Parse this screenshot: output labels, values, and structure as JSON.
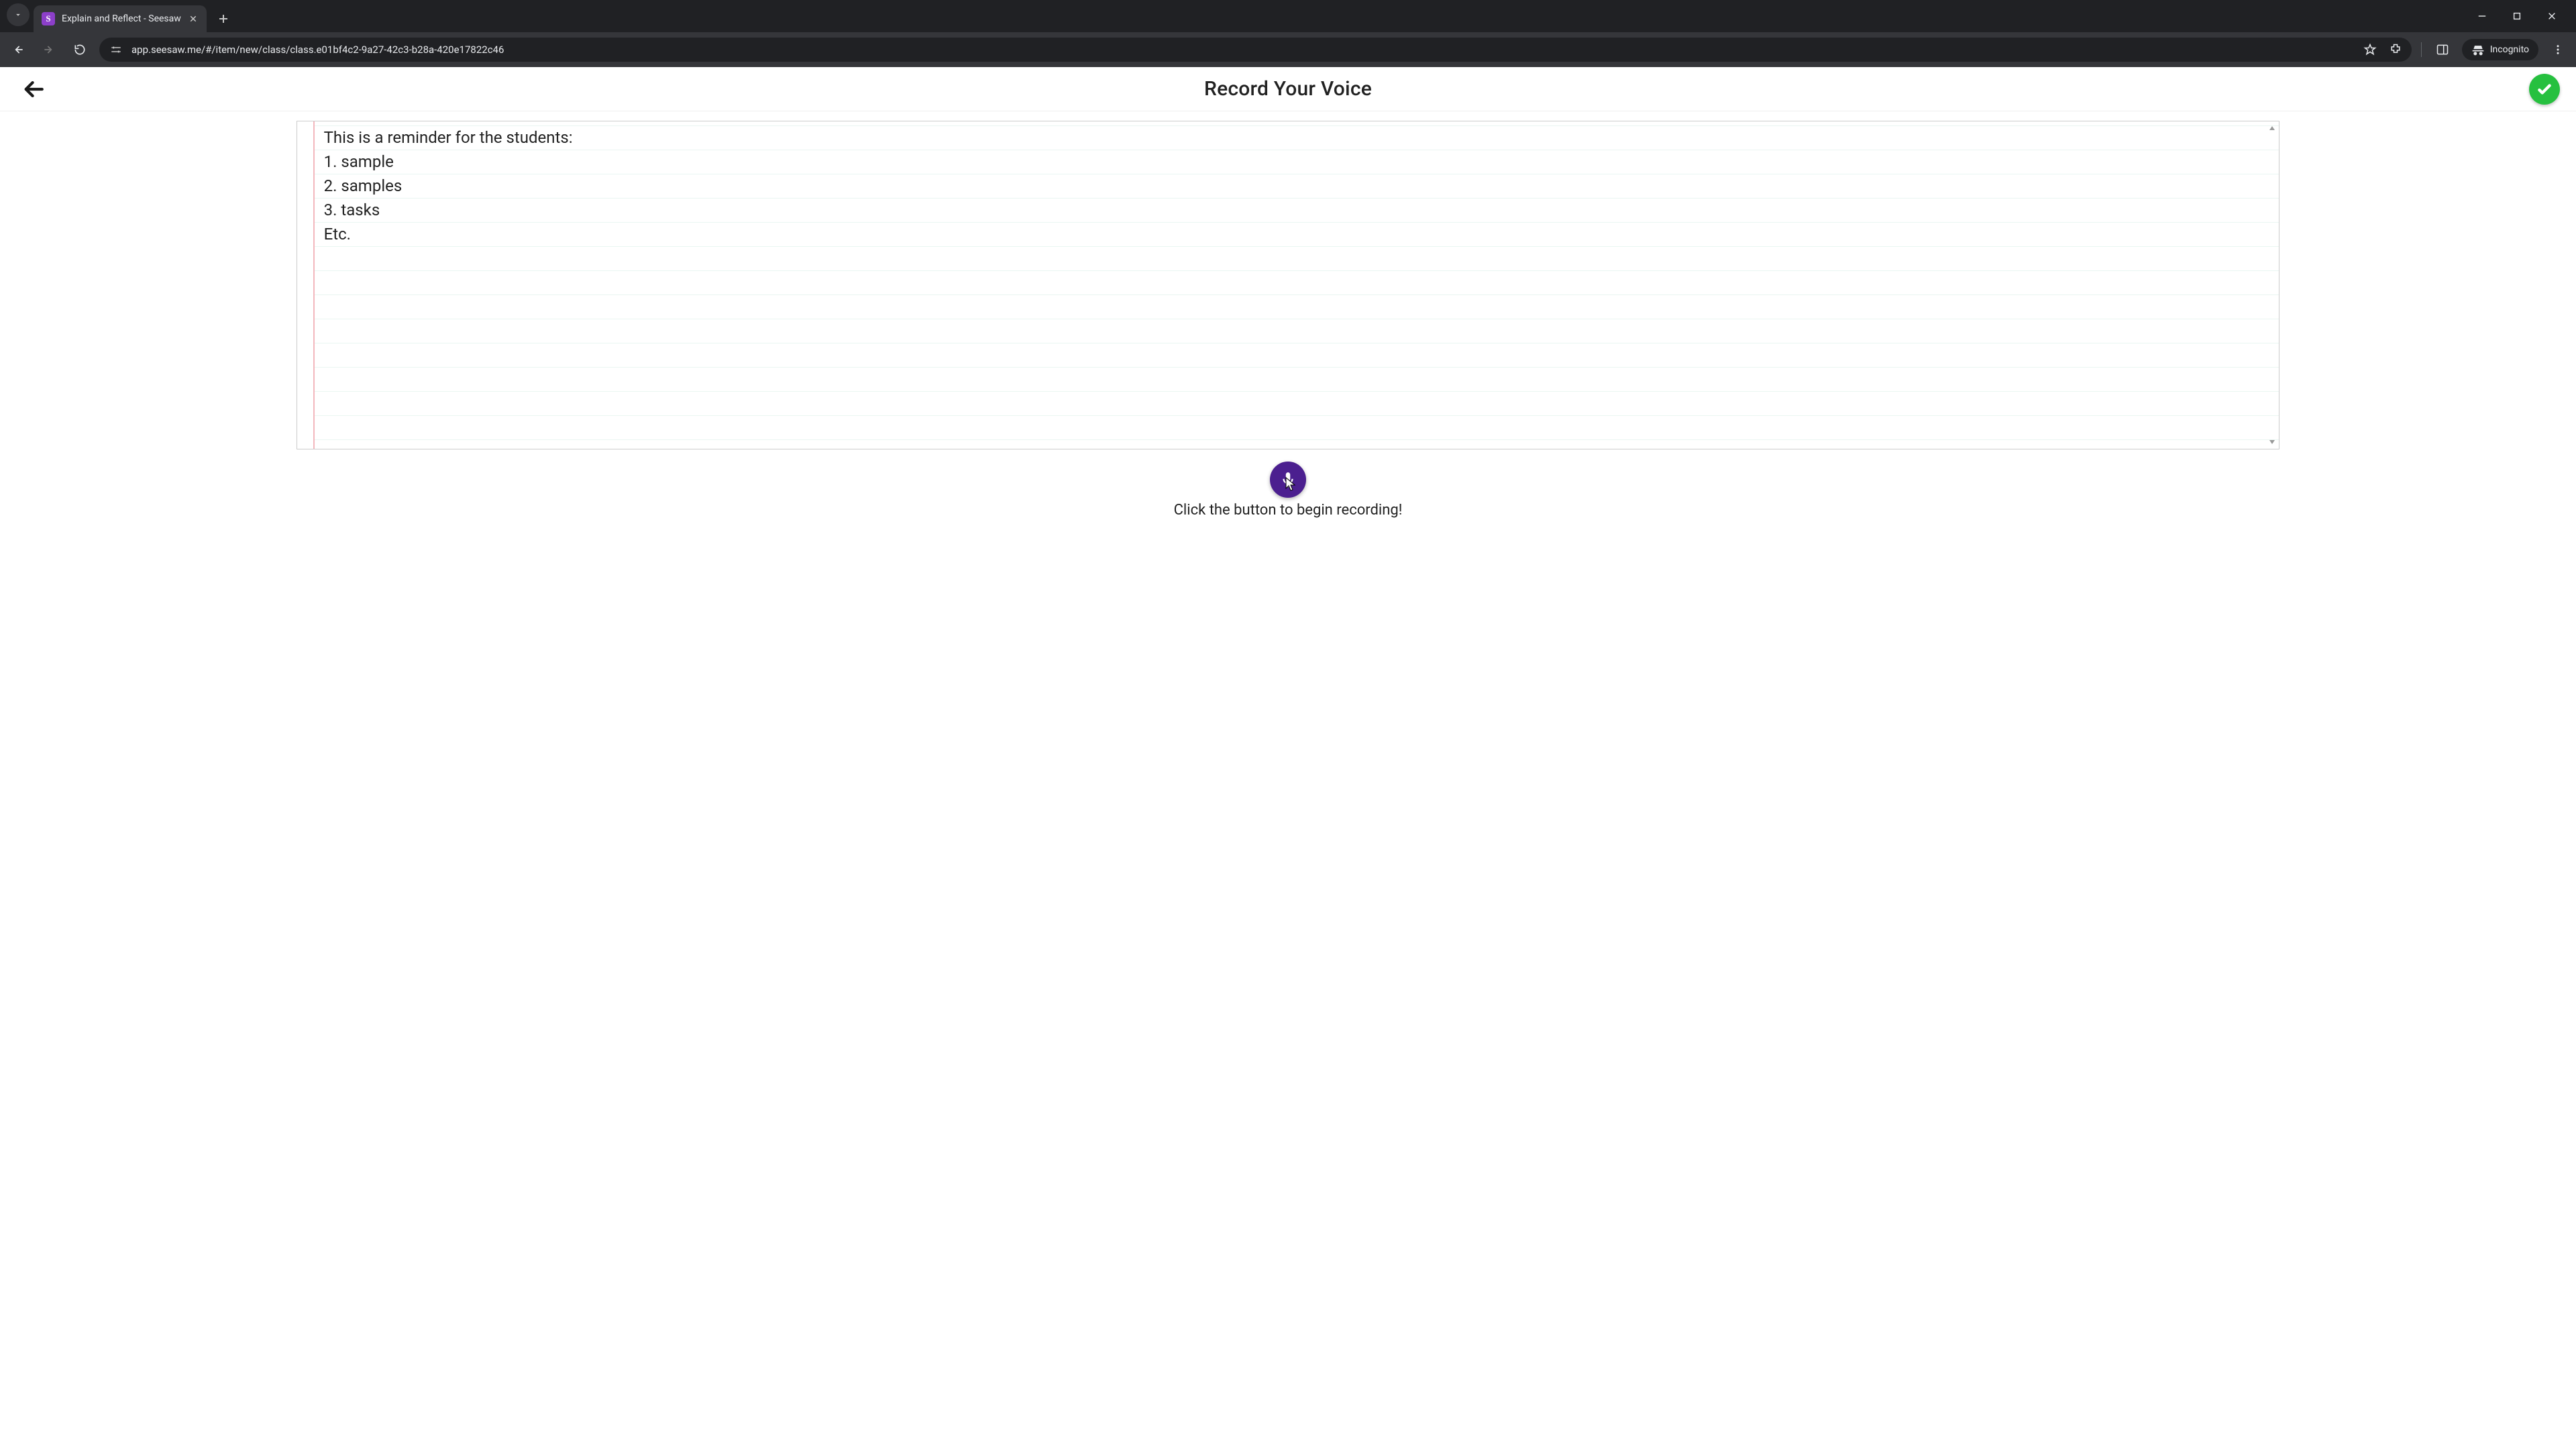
{
  "browser": {
    "tab_title": "Explain and Reflect - Seesaw",
    "favicon_letter": "S",
    "url": "app.seesaw.me/#/item/new/class/class.e01bf4c2-9a27-42c3-b28a-420e17822c46",
    "incognito_label": "Incognito"
  },
  "app": {
    "header_title": "Record Your Voice",
    "note_lines": [
      "This is a reminder for the students:",
      "1. sample",
      "2. samples",
      "3. tasks",
      "Etc."
    ],
    "record_caption": "Click the button to begin recording!"
  },
  "colors": {
    "record_button": "#4b1f8f",
    "confirm_button": "#26c03f",
    "seesaw_purple": "#8c3fc9"
  }
}
